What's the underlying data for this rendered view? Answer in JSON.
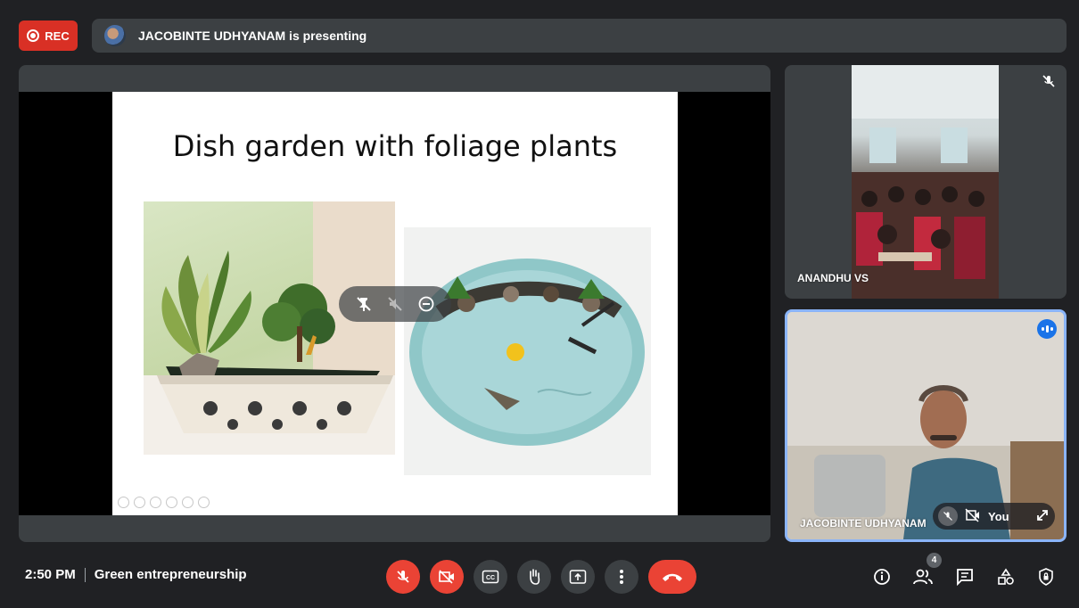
{
  "topbar": {
    "rec_label": "REC",
    "presenting_text": "JACOBINTE UDHYANAM is presenting"
  },
  "slide": {
    "title": "Dish garden with foliage plants"
  },
  "participants": [
    {
      "name": "ANANDHU VS",
      "muted": true
    },
    {
      "name": "JACOBINTE UDHYANAM",
      "self_label": "You",
      "speaking": true
    }
  ],
  "bottom": {
    "time": "2:50 PM",
    "meeting_title": "Green entrepreneurship",
    "people_count": "4"
  },
  "colors": {
    "accent_red": "#ea4335",
    "bar_grey": "#3c4043",
    "speaking_blue": "#1a73e8",
    "highlight_border": "#8ab4f8"
  },
  "icons": [
    "record-icon",
    "mic-off-icon",
    "camera-off-icon",
    "captions-icon",
    "raise-hand-icon",
    "present-icon",
    "more-options-icon",
    "hang-up-icon",
    "info-icon",
    "people-icon",
    "chat-icon",
    "activities-icon",
    "host-controls-icon",
    "pin-icon",
    "mute-icon",
    "remove-icon",
    "expand-icon"
  ]
}
